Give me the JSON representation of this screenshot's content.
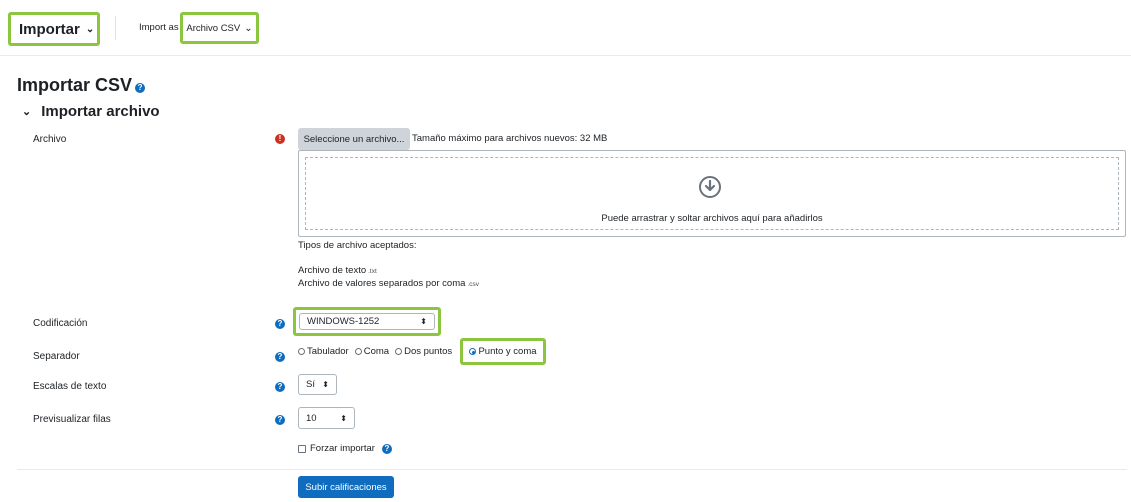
{
  "topbar": {
    "action_menu": "Importar",
    "import_as_label": "Import as",
    "import_as_value": "Archivo CSV"
  },
  "page": {
    "title": "Importar CSV",
    "section_title": "Importar archivo"
  },
  "form": {
    "archivo": {
      "label": "Archivo",
      "choose_button": "Seleccione un archivo...",
      "max_size": "Tamaño máximo para archivos nuevos: 32 MB",
      "dropzone_text": "Puede arrastrar y soltar archivos aquí para añadirlos",
      "accepted_heading": "Tipos de archivo aceptados:",
      "accepted": [
        {
          "name": "Archivo de texto",
          "ext": ".txt"
        },
        {
          "name": "Archivo de valores separados por coma",
          "ext": ".csv"
        }
      ]
    },
    "codificacion": {
      "label": "Codificación",
      "value": "WINDOWS-1252"
    },
    "separador": {
      "label": "Separador",
      "options": [
        "Tabulador",
        "Coma",
        "Dos puntos",
        "Punto y coma"
      ],
      "selected": "Punto y coma"
    },
    "escalas": {
      "label": "Escalas de texto",
      "value": "Sí"
    },
    "previsualizar": {
      "label": "Previsualizar filas",
      "value": "10"
    },
    "forzar": {
      "label": "Forzar importar",
      "checked": false
    },
    "submit": "Subir calificaciones"
  },
  "colors": {
    "highlight": "#8cc63f",
    "primary": "#0f6cbf",
    "required": "#ca3120"
  }
}
